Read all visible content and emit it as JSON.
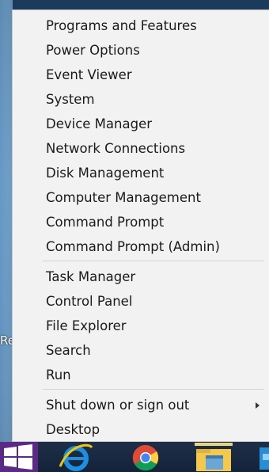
{
  "menu": {
    "items": [
      {
        "label": "Programs and Features"
      },
      {
        "label": "Power Options"
      },
      {
        "label": "Event Viewer"
      },
      {
        "label": "System"
      },
      {
        "label": "Device Manager"
      },
      {
        "label": "Network Connections"
      },
      {
        "label": "Disk Management"
      },
      {
        "label": "Computer Management"
      },
      {
        "label": "Command Prompt"
      },
      {
        "label": "Command Prompt (Admin)"
      },
      {
        "label": "Task Manager"
      },
      {
        "label": "Control Panel"
      },
      {
        "label": "File Explorer"
      },
      {
        "label": "Search"
      },
      {
        "label": "Run"
      },
      {
        "label": "Shut down or sign out"
      },
      {
        "label": "Desktop"
      }
    ]
  },
  "desktop": {
    "partial_label": "Re"
  },
  "taskbar": {
    "icons": [
      "windows-logo-icon",
      "internet-explorer-icon",
      "chrome-icon",
      "file-explorer-icon",
      "store-icon"
    ],
    "start_color": "#5b2a86"
  }
}
